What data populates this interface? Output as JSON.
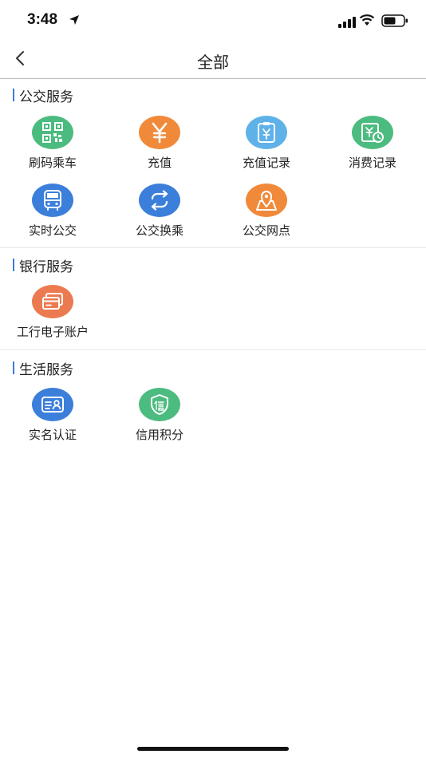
{
  "status_bar": {
    "time": "3:48"
  },
  "nav": {
    "title": "全部"
  },
  "sections": [
    {
      "title": "公交服务",
      "items": [
        {
          "label": "刷码乘车",
          "icon": "qr-code-icon",
          "color": "#4cbb7f"
        },
        {
          "label": "充值",
          "icon": "yen-icon",
          "color": "#f08a3a"
        },
        {
          "label": "充值记录",
          "icon": "recharge-record-icon",
          "color": "#5fb2e8"
        },
        {
          "label": "消费记录",
          "icon": "consumption-record-icon",
          "color": "#4cbb7f"
        },
        {
          "label": "实时公交",
          "icon": "bus-icon",
          "color": "#3b7fdb"
        },
        {
          "label": "公交换乘",
          "icon": "transfer-icon",
          "color": "#3b7fdb"
        },
        {
          "label": "公交网点",
          "icon": "map-pin-icon",
          "color": "#f08a3a"
        }
      ]
    },
    {
      "title": "银行服务",
      "items": [
        {
          "label": "工行电子账户",
          "icon": "bank-card-icon",
          "color": "#ec7a50"
        }
      ]
    },
    {
      "title": "生活服务",
      "items": [
        {
          "label": "实名认证",
          "icon": "id-card-icon",
          "color": "#3b7fdb"
        },
        {
          "label": "信用积分",
          "icon": "credit-shield-icon",
          "color": "#4cbb7f"
        }
      ]
    }
  ]
}
